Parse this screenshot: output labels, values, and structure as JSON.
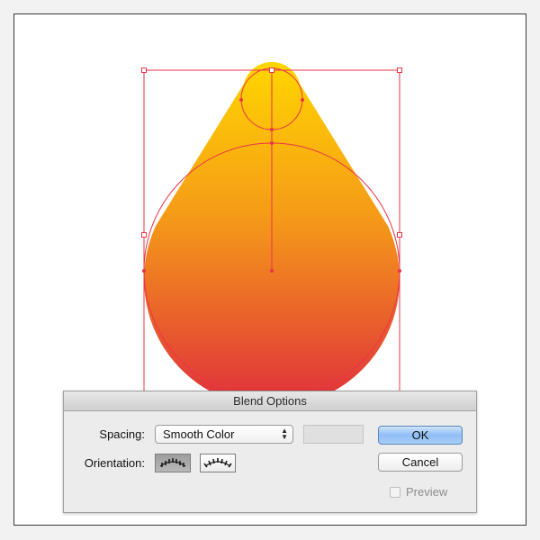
{
  "colors": {
    "selection": "#e8344a",
    "gradient_top": "#ffd600",
    "gradient_mid": "#f58a1a",
    "gradient_bottom": "#e0303a",
    "ok_accent": "#8fbdf5"
  },
  "dialog": {
    "title": "Blend Options",
    "spacing_label": "Spacing:",
    "spacing_value": "Smooth Color",
    "spacing_arrows_icon": "up-down-chevron-icon",
    "orientation_label": "Orientation:",
    "orientation_options": [
      "align-to-page-icon",
      "align-to-path-icon"
    ],
    "orientation_selected": "align-to-page-icon",
    "ok_label": "OK",
    "cancel_label": "Cancel",
    "preview_label": "Preview",
    "preview_checked": false
  }
}
